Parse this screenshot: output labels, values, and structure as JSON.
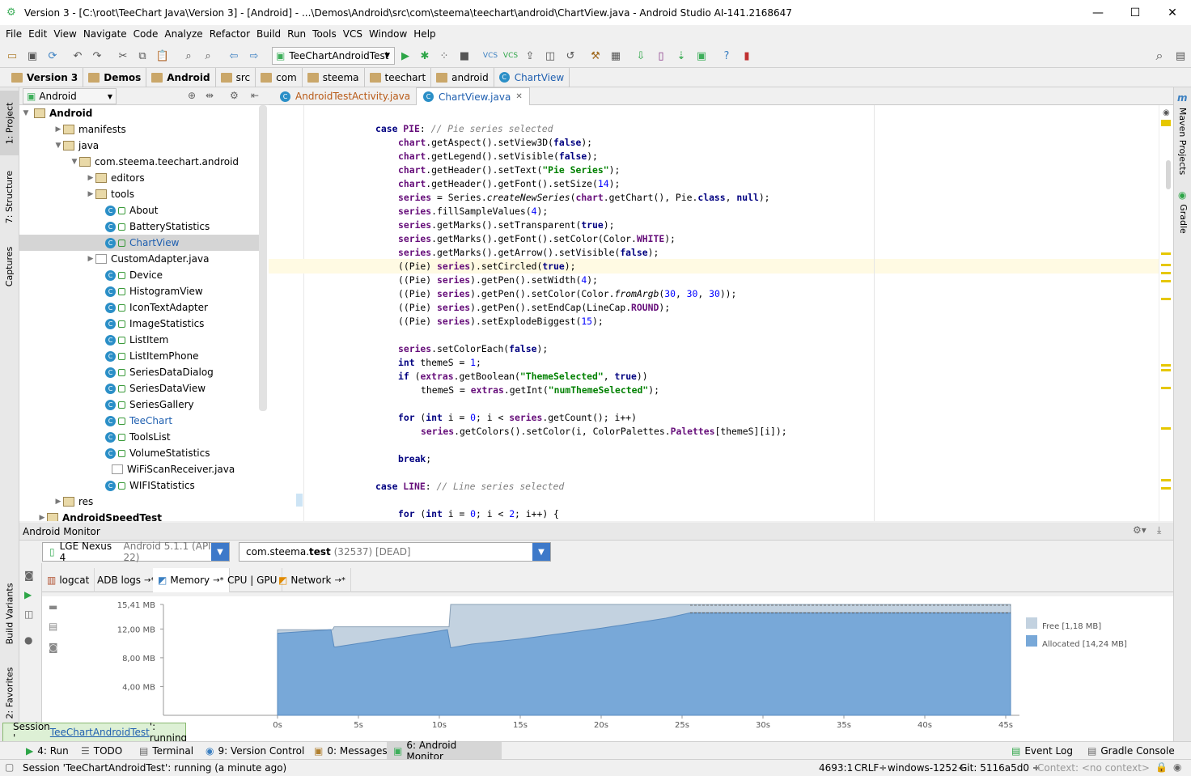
{
  "window": {
    "title": "Version 3 - [C:\\root\\TeeChart Java\\Version 3] - [Android] - ...\\Demos\\Android\\src\\com\\steema\\teechart\\android\\ChartView.java - Android Studio AI-141.2168647"
  },
  "menu": [
    "File",
    "Edit",
    "View",
    "Navigate",
    "Code",
    "Analyze",
    "Refactor",
    "Build",
    "Run",
    "Tools",
    "VCS",
    "Window",
    "Help"
  ],
  "toolbar": {
    "run_config": "TeeChartAndroidTest"
  },
  "breadcrumbs": [
    "Version 3",
    "Demos",
    "Android",
    "src",
    "com",
    "steema",
    "teechart",
    "android",
    "ChartView"
  ],
  "left_tabs": {
    "project": "1: Project",
    "structure": "7: Structure",
    "captures": "Captures",
    "build_variants": "Build Variants",
    "favorites": "2: Favorites"
  },
  "right_tabs": {
    "maven": "Maven Projects",
    "gradle": "Gradle"
  },
  "project": {
    "view": "Android",
    "root": "Android",
    "tree": [
      {
        "label": "manifests",
        "type": "folder",
        "depth": 1,
        "arrow": "▶"
      },
      {
        "label": "java",
        "type": "folder",
        "depth": 1,
        "arrow": "▼"
      },
      {
        "label": "com.steema.teechart.android",
        "type": "folder",
        "depth": 2,
        "arrow": "▼"
      },
      {
        "label": "editors",
        "type": "folder",
        "depth": 3,
        "arrow": "▶"
      },
      {
        "label": "tools",
        "type": "folder",
        "depth": 3,
        "arrow": "▶"
      },
      {
        "label": "About",
        "type": "class",
        "depth": 4
      },
      {
        "label": "BatteryStatistics",
        "type": "class",
        "depth": 4
      },
      {
        "label": "ChartView",
        "type": "class",
        "depth": 4,
        "selected": true
      },
      {
        "label": "CustomAdapter.java",
        "type": "file",
        "depth": 3,
        "arrow": "▶"
      },
      {
        "label": "Device",
        "type": "class",
        "depth": 4
      },
      {
        "label": "HistogramView",
        "type": "class",
        "depth": 4
      },
      {
        "label": "IconTextAdapter",
        "type": "class",
        "depth": 4
      },
      {
        "label": "ImageStatistics",
        "type": "class",
        "depth": 4
      },
      {
        "label": "ListItem",
        "type": "class",
        "depth": 4
      },
      {
        "label": "ListItemPhone",
        "type": "class",
        "depth": 4
      },
      {
        "label": "SeriesDataDialog",
        "type": "class",
        "depth": 4
      },
      {
        "label": "SeriesDataView",
        "type": "class",
        "depth": 4
      },
      {
        "label": "SeriesGallery",
        "type": "class",
        "depth": 4
      },
      {
        "label": "TeeChart",
        "type": "class",
        "depth": 4,
        "blue": true
      },
      {
        "label": "ToolsList",
        "type": "class",
        "depth": 4
      },
      {
        "label": "VolumeStatistics",
        "type": "class",
        "depth": 4
      },
      {
        "label": "WiFiScanReceiver.java",
        "type": "file",
        "depth": 4
      },
      {
        "label": "WIFIStatistics",
        "type": "class",
        "depth": 4
      },
      {
        "label": "res",
        "type": "folder",
        "depth": 1,
        "arrow": "▶"
      },
      {
        "label": "AndroidSpeedTest",
        "type": "module",
        "depth": 0,
        "arrow": "▶"
      }
    ]
  },
  "editor": {
    "tabs": [
      "AndroidTestActivity.java",
      "ChartView.java"
    ],
    "active_tab": "ChartView.java",
    "lines": [
      [
        4,
        [
          [
            "kw",
            "case "
          ],
          [
            "fld",
            "PIE"
          ],
          [
            "",
            ": "
          ],
          [
            "cmt",
            "// Pie series selected"
          ]
        ]
      ],
      [
        6,
        [
          [
            "fld",
            "chart"
          ],
          [
            "",
            ".getAspect().setView3D("
          ],
          [
            "kw",
            "false"
          ],
          [
            "",
            ");"
          ]
        ]
      ],
      [
        6,
        [
          [
            "fld",
            "chart"
          ],
          [
            "",
            ".getLegend().setVisible("
          ],
          [
            "kw",
            "false"
          ],
          [
            "",
            ");"
          ]
        ]
      ],
      [
        6,
        [
          [
            "fld",
            "chart"
          ],
          [
            "",
            ".getHeader().setText("
          ],
          [
            "str",
            "\"Pie Series\""
          ],
          [
            "",
            ");"
          ]
        ]
      ],
      [
        6,
        [
          [
            "fld",
            "chart"
          ],
          [
            "",
            ".getHeader().getFont().setSize("
          ],
          [
            "num",
            "14"
          ],
          [
            "",
            ");"
          ]
        ]
      ],
      [
        6,
        [
          [
            "fld",
            "series"
          ],
          [
            "",
            " = Series."
          ],
          [
            "ital",
            "createNewSeries"
          ],
          [
            "",
            "("
          ],
          [
            "fld",
            "chart"
          ],
          [
            "",
            ".getChart(), Pie."
          ],
          [
            "kw",
            "class"
          ],
          [
            "",
            ", "
          ],
          [
            "kw",
            "null"
          ],
          [
            "",
            ");"
          ]
        ]
      ],
      [
        6,
        [
          [
            "fld",
            "series"
          ],
          [
            "",
            ".fillSampleValues("
          ],
          [
            "num",
            "4"
          ],
          [
            "",
            ");"
          ]
        ]
      ],
      [
        6,
        [
          [
            "fld",
            "series"
          ],
          [
            "",
            ".getMarks().setTransparent("
          ],
          [
            "kw",
            "true"
          ],
          [
            "",
            ");"
          ]
        ]
      ],
      [
        6,
        [
          [
            "fld",
            "series"
          ],
          [
            "",
            ".getMarks().getFont().setColor(Color."
          ],
          [
            "fld",
            "WHITE"
          ],
          [
            "",
            ");"
          ]
        ]
      ],
      [
        6,
        [
          [
            "fld",
            "series"
          ],
          [
            "",
            ".getMarks().getArrow().setVisible("
          ],
          [
            "kw",
            "false"
          ],
          [
            "",
            ");"
          ]
        ]
      ],
      [
        6,
        [
          [
            "",
            "((Pie) "
          ],
          [
            "fld",
            "series"
          ],
          [
            "",
            ").setCircled("
          ],
          [
            "kw",
            "true"
          ],
          [
            "",
            ");"
          ]
        ]
      ],
      [
        6,
        [
          [
            "",
            "((Pie) "
          ],
          [
            "fld",
            "series"
          ],
          [
            "",
            ").getPen().setWidth("
          ],
          [
            "num",
            "4"
          ],
          [
            "",
            ");"
          ]
        ]
      ],
      [
        6,
        [
          [
            "",
            "((Pie) "
          ],
          [
            "fld",
            "series"
          ],
          [
            "",
            ").getPen().setColor(Color."
          ],
          [
            "ital",
            "fromArgb"
          ],
          [
            "",
            "("
          ],
          [
            "num",
            "30"
          ],
          [
            "",
            ", "
          ],
          [
            "num",
            "30"
          ],
          [
            "",
            ", "
          ],
          [
            "num",
            "30"
          ],
          [
            "",
            "));"
          ]
        ]
      ],
      [
        6,
        [
          [
            "",
            "((Pie) "
          ],
          [
            "fld",
            "series"
          ],
          [
            "",
            ").getPen().setEndCap(LineCap."
          ],
          [
            "fld",
            "ROUND"
          ],
          [
            "",
            ");"
          ]
        ]
      ],
      [
        6,
        [
          [
            "",
            "((Pie) "
          ],
          [
            "fld",
            "series"
          ],
          [
            "",
            ").setExplodeBiggest("
          ],
          [
            "num",
            "15"
          ],
          [
            "",
            ");"
          ]
        ]
      ],
      [
        0,
        []
      ],
      [
        6,
        [
          [
            "fld",
            "series"
          ],
          [
            "",
            ".setColorEach("
          ],
          [
            "kw",
            "false"
          ],
          [
            "",
            ");"
          ]
        ]
      ],
      [
        6,
        [
          [
            "kw",
            "int"
          ],
          [
            "",
            " themeS = "
          ],
          [
            "num",
            "1"
          ],
          [
            "",
            ";"
          ]
        ]
      ],
      [
        6,
        [
          [
            "kw",
            "if"
          ],
          [
            "",
            " ("
          ],
          [
            "fld",
            "extras"
          ],
          [
            "",
            ".getBoolean("
          ],
          [
            "str",
            "\"ThemeSelected\""
          ],
          [
            "",
            ", "
          ],
          [
            "kw",
            "true"
          ],
          [
            "",
            "))"
          ]
        ]
      ],
      [
        8,
        [
          [
            "",
            "themeS = "
          ],
          [
            "fld",
            "extras"
          ],
          [
            "",
            ".getInt("
          ],
          [
            "str",
            "\"numThemeSelected\""
          ],
          [
            "",
            ");"
          ]
        ]
      ],
      [
        0,
        []
      ],
      [
        6,
        [
          [
            "kw",
            "for"
          ],
          [
            "",
            " ("
          ],
          [
            "kw",
            "int"
          ],
          [
            "",
            " i = "
          ],
          [
            "num",
            "0"
          ],
          [
            "",
            "; i < "
          ],
          [
            "fld",
            "series"
          ],
          [
            "",
            ".getCount(); i++)"
          ]
        ]
      ],
      [
        8,
        [
          [
            "fld",
            "series"
          ],
          [
            "",
            ".getColors().setColor(i, ColorPalettes."
          ],
          [
            "fld",
            "Palettes"
          ],
          [
            "",
            "[themeS][i]);"
          ]
        ]
      ],
      [
        0,
        []
      ],
      [
        6,
        [
          [
            "kw",
            "break"
          ],
          [
            "",
            ";"
          ]
        ]
      ],
      [
        0,
        []
      ],
      [
        4,
        [
          [
            "kw",
            "case "
          ],
          [
            "fld",
            "LINE"
          ],
          [
            "",
            ": "
          ],
          [
            "cmt",
            "// Line series selected"
          ]
        ]
      ],
      [
        0,
        []
      ],
      [
        6,
        [
          [
            "kw",
            "for"
          ],
          [
            "",
            " ("
          ],
          [
            "kw",
            "int"
          ],
          [
            "",
            " i = "
          ],
          [
            "num",
            "0"
          ],
          [
            "",
            "; i < "
          ],
          [
            "num",
            "2"
          ],
          [
            "",
            "; i++) {"
          ]
        ]
      ]
    ]
  },
  "monitor": {
    "title": "Android Monitor",
    "device": "LGE Nexus 4",
    "device_detail": "Android 5.1.1 (API 22)",
    "process": "com.steema.",
    "process_bold": "test",
    "process_detail": "(32537) [DEAD]",
    "tabs": [
      "logcat",
      "ADB logs",
      "Memory",
      "CPU | GPU",
      "Network"
    ],
    "active_tab": "Memory"
  },
  "chart_data": {
    "type": "area",
    "ylabels": [
      "15,41 MB",
      "12,00 MB",
      "8,00 MB",
      "4,00 MB"
    ],
    "xlabels": [
      "0s",
      "5s",
      "10s",
      "15s",
      "20s",
      "25s",
      "30s",
      "35s",
      "40s",
      "45s"
    ],
    "series": [
      {
        "name": "Free [1,18 MB]",
        "color": "#c3d2e0",
        "x": [
          0,
          3.4,
          3.5,
          10.6,
          10.7,
          45.3
        ],
        "y": [
          11.9,
          11.9,
          12.3,
          12.3,
          15.41,
          15.41
        ]
      },
      {
        "name": "Allocated [14,24 MB]",
        "color": "#78a8d8",
        "x": [
          0,
          3.3,
          3.5,
          3.6,
          10.5,
          10.7,
          12,
          15,
          20,
          24,
          25.5,
          45.3
        ],
        "y": [
          11.4,
          11.9,
          9.5,
          9.5,
          11.9,
          9.4,
          9.9,
          10.6,
          12.1,
          13.5,
          14.24,
          14.24
        ]
      }
    ]
  },
  "bottom_tabs": {
    "run": "4: Run",
    "todo": "TODO",
    "terminal": "Terminal",
    "vcs": "9: Version Control",
    "messages": "0: Messages",
    "monitor": "6: Android Monitor",
    "eventlog": "Event Log",
    "gradle": "Gradle Console"
  },
  "popup": {
    "prefix": "Session '",
    "link": "TeeChartAndroidTest",
    "suffix": "': running"
  },
  "status": {
    "message": "Session 'TeeChartAndroidTest': running (a minute ago)",
    "position": "4693:1",
    "line_sep": "CRLF÷",
    "encoding": "windows-1252÷",
    "git": "Git: 5116a5d0 ÷",
    "context": "Context: <no context>"
  }
}
